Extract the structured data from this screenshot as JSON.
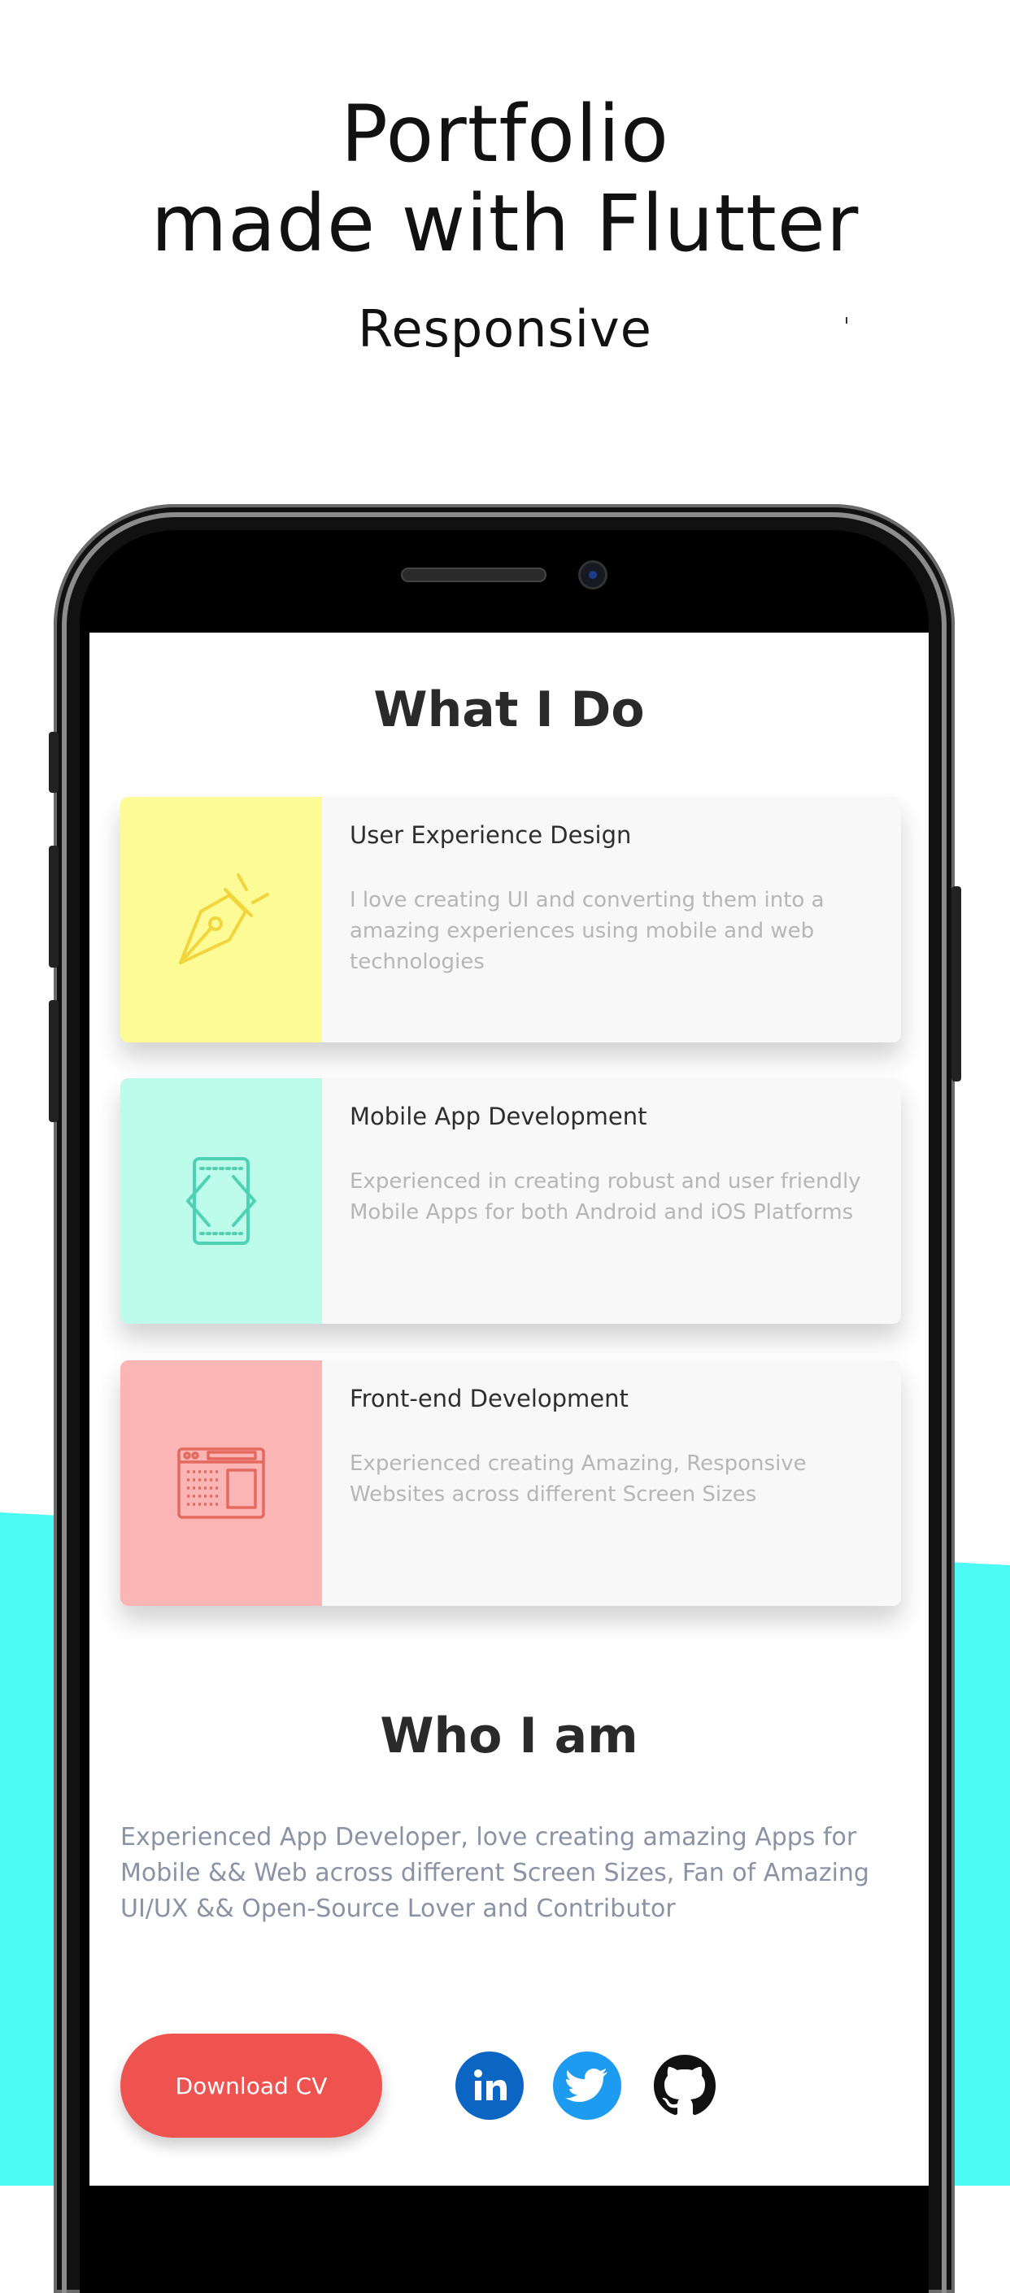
{
  "hero": {
    "title_line1": "Portfolio",
    "title_line2": "made with Flutter",
    "subtitle": "Responsive"
  },
  "colors": {
    "accent_cyan": "#4dfbf5",
    "card_yellow": "#fcfb96",
    "card_mint": "#bdfbeb",
    "card_pink": "#fbb5b4",
    "button_red": "#ef5350"
  },
  "what_i_do": {
    "heading": "What I Do",
    "cards": [
      {
        "title": "User Experience Design",
        "description": "I love creating UI and converting them into a amazing experiences using mobile and web technologies",
        "icon": "pen-nib-icon"
      },
      {
        "title": "Mobile App Development",
        "description": "Experienced in creating robust and user friendly Mobile Apps for both Android and iOS Platforms",
        "icon": "mobile-code-icon"
      },
      {
        "title": "Front-end Development",
        "description": "Experienced creating Amazing, Responsive Websites across different Screen Sizes",
        "icon": "browser-window-icon"
      }
    ]
  },
  "who_i_am": {
    "heading": "Who I am",
    "description": "Experienced App Developer, love creating amazing Apps for Mobile && Web across different Screen Sizes, Fan of Amazing UI/UX && Open-Source Lover and Contributor"
  },
  "actions": {
    "download_cv_label": "Download CV",
    "social": [
      "linkedin-icon",
      "twitter-icon",
      "github-icon"
    ]
  }
}
